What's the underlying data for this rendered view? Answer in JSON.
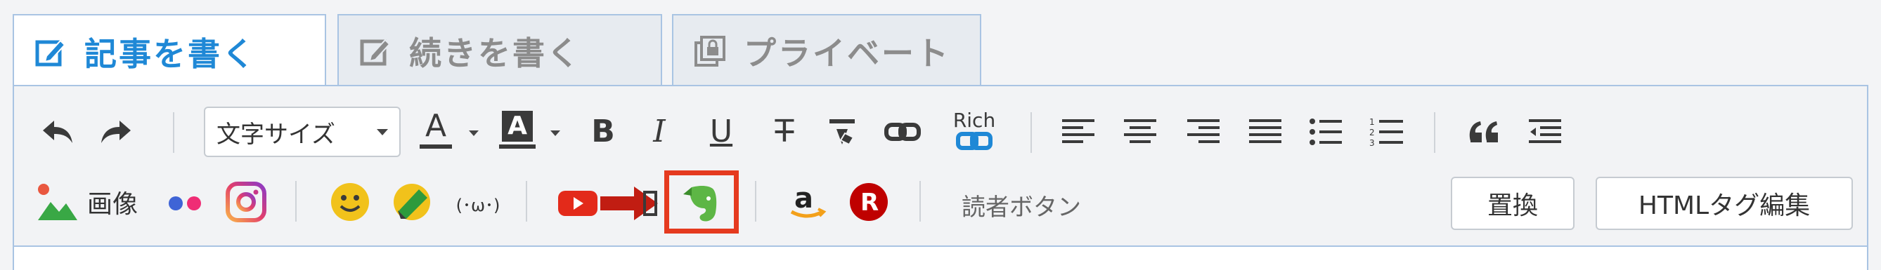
{
  "tabs": [
    {
      "label": "記事を書く",
      "icon": "pencil-square-icon",
      "active": true
    },
    {
      "label": "続きを書く",
      "icon": "pencil-square-icon",
      "active": false
    },
    {
      "label": "プライベート",
      "icon": "lock-copy-icon",
      "active": false
    }
  ],
  "toolbar_row1": {
    "undo": "undo-icon",
    "redo": "redo-icon",
    "font_size_label": "文字サイズ",
    "font_color_glyph": "A",
    "bg_color_glyph": "A",
    "bold_glyph": "B",
    "italic_glyph": "I",
    "underline_glyph": "U",
    "strike_glyph": "T",
    "rich_label": "Rich"
  },
  "toolbar_row2": {
    "image_label": "画像",
    "kaomoji_label": "(･ω･)",
    "reader_button_label": "読者ボタン",
    "replace_label": "置換",
    "html_tag_edit_label": "HTMLタグ編集"
  },
  "colors": {
    "accent": "#1f88d6",
    "tab_border": "#a9c4e3",
    "highlight": "#e53a1f",
    "evernote_green": "#5db645",
    "youtube_red": "#e32a1a",
    "rakuten_red": "#bf0000"
  }
}
